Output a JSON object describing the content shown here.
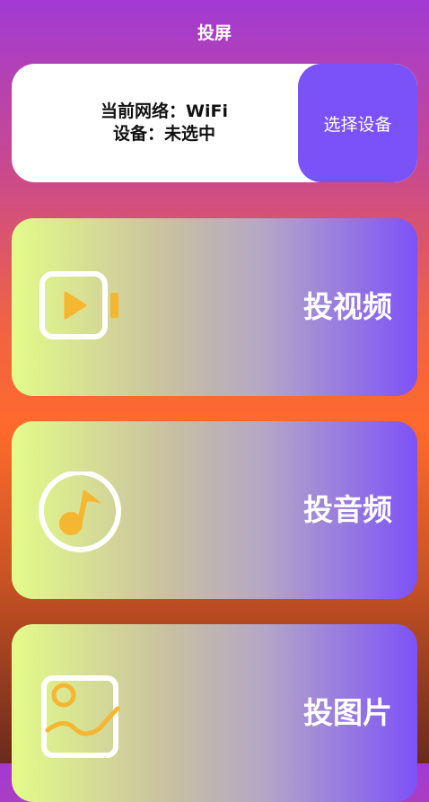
{
  "header": {
    "title": "投屏"
  },
  "device_card": {
    "network_line": "当前网络：WiFi",
    "device_line": "设备：未选中",
    "select_button": "选择设备"
  },
  "cast_options": [
    {
      "label": "投视频",
      "icon": "video-icon"
    },
    {
      "label": "投音频",
      "icon": "music-note-icon"
    },
    {
      "label": "投图片",
      "icon": "image-icon"
    }
  ],
  "colors": {
    "accent_purple": "#7b52f7",
    "icon_yellow": "#f5b731",
    "card_gradient_start": "#e3fb8a",
    "card_gradient_end": "#7d52f8"
  }
}
